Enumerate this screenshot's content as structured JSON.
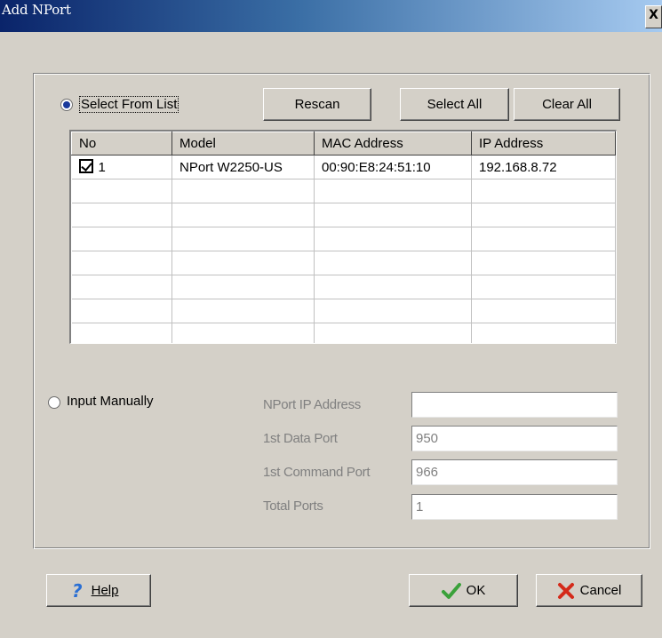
{
  "window": {
    "title": "Add NPort",
    "close_glyph": "X"
  },
  "select_from_list": {
    "label": "Select From List",
    "selected": true
  },
  "buttons": {
    "rescan": "Rescan",
    "select_all": "Select All",
    "clear_all": "Clear All",
    "help": "Help",
    "ok": "OK",
    "cancel": "Cancel"
  },
  "table": {
    "columns": [
      "No",
      "Model",
      "MAC Address",
      "IP Address"
    ],
    "rows": [
      {
        "checked": true,
        "no": "1",
        "model": "NPort W2250-US",
        "mac": "00:90:E8:24:51:10",
        "ip": "192.168.8.72"
      }
    ],
    "empty_rows": 7
  },
  "input_manually": {
    "label": "Input Manually",
    "selected": false,
    "fields": {
      "ip_address": {
        "label": "NPort IP Address",
        "value": ""
      },
      "data_port": {
        "label": "1st Data Port",
        "value": "950"
      },
      "command_port": {
        "label": "1st Command Port",
        "value": "966"
      },
      "total_ports": {
        "label": "Total Ports",
        "value": "1"
      }
    }
  },
  "icons": {
    "help": "question-mark-icon",
    "ok": "checkmark-icon",
    "cancel": "red-x-icon"
  },
  "colors": {
    "title_gradient_start": "#0a246a",
    "title_gradient_end": "#a6caf0",
    "dialog_bg": "#d4d0c8",
    "ok_check": "#3aa13a",
    "cancel_x": "#d42a1a",
    "help_icon": "#2a6fd4"
  }
}
